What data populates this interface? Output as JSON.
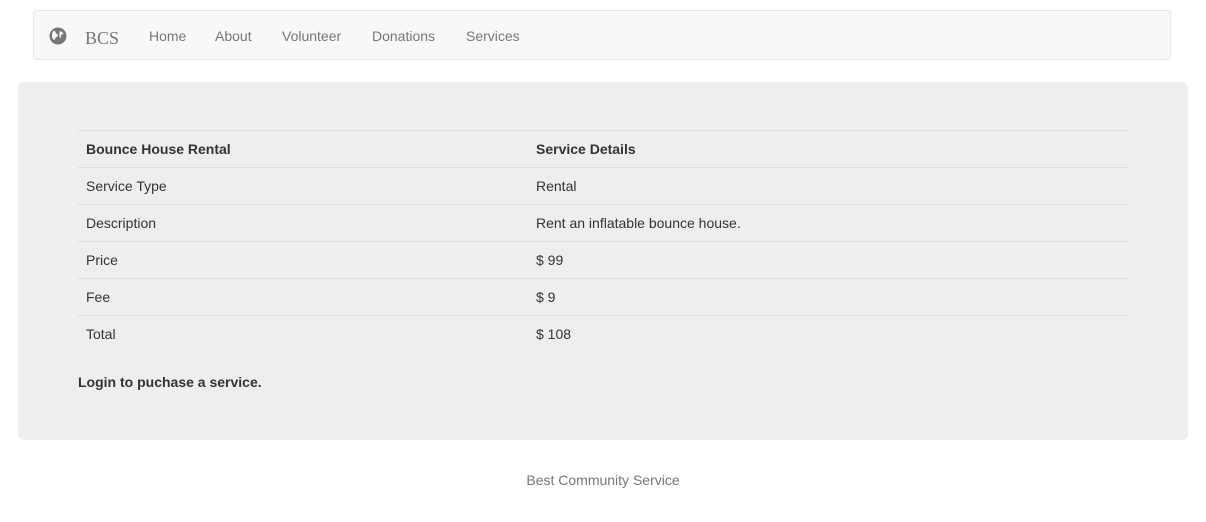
{
  "navbar": {
    "brand": "BCS",
    "brand_icon": "globe-icon",
    "links": [
      "Home",
      "About",
      "Volunteer",
      "Donations",
      "Services"
    ]
  },
  "service_table": {
    "headers": [
      "Bounce House Rental",
      "Service Details"
    ],
    "rows": [
      [
        "Service Type",
        "Rental"
      ],
      [
        "Description",
        "Rent an inflatable bounce house."
      ],
      [
        "Price",
        "$ 99"
      ],
      [
        "Fee",
        "$ 9"
      ],
      [
        "Total",
        "$ 108"
      ]
    ]
  },
  "login_message": "Login to puchase a service.",
  "footer": {
    "text": "Best Community Service"
  },
  "colors": {
    "navbar_bg": "#f8f8f8",
    "panel_bg": "#eeeeee",
    "link": "#777777",
    "text": "#333333"
  }
}
